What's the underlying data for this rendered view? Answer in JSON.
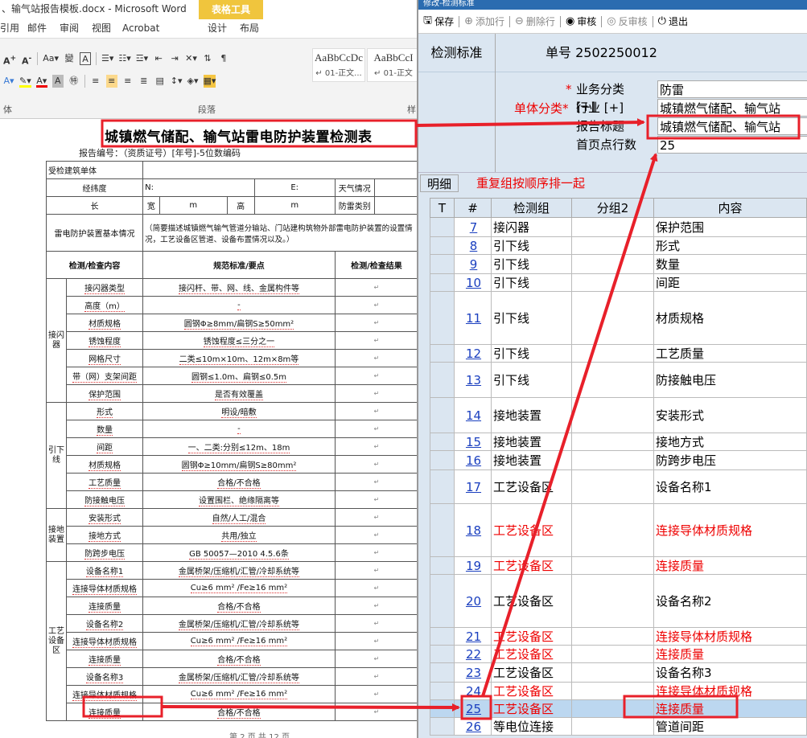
{
  "word": {
    "title": "、输气站报告模板.docx - Microsoft Word",
    "context_tab": "表格工具",
    "tabs": [
      "引用",
      "邮件",
      "审阅",
      "视图",
      "Acrobat",
      "设计",
      "布局"
    ],
    "ribbon": {
      "font_row": [
        "A",
        "A",
        "Aa",
        "变",
        "A"
      ],
      "para_label": "段落",
      "font_label": "体",
      "style1_sample": "AaBbCcDc",
      "style1_name": "↵ 01-正文...",
      "style2_sample": "AaBbCcI",
      "style2_name": "↵ 01-正文",
      "styles_label": "样"
    },
    "doc": {
      "title": "城镇燃气储配、输气站雷电防护装置检测表",
      "subtitle": "报告编号：（资质证号）[年号]-5位数编码",
      "footer": "第 2 页 共 12 页",
      "rows": {
        "r0": "受检建筑单体",
        "r1a": "经纬度",
        "r1b": "N:",
        "r1c": "E:",
        "r1d": "天气情况",
        "r2a": "长",
        "r2b": "m",
        "r2c": "宽",
        "r2d": "m",
        "r2e": "高",
        "r2f": "m",
        "r2g": "防雷类别",
        "r3a": "雷电防护装置基本情况",
        "r3b": "（简要描述城镇燃气输气管道分输站、门站建构筑物外部雷电防护装置的设置情况，工艺设备区管道、设备布置情况以及。）",
        "hdr1": "检测/检查内容",
        "hdr2": "规范标准/要点",
        "hdr3": "检测/检查结果"
      },
      "groups": [
        {
          "name": "接闪器",
          "items": [
            [
              "接闪器类型",
              "接闪杆、带、网、线、金属构件等"
            ],
            [
              "高度（m）",
              "-"
            ],
            [
              "材质规格",
              "圆钢Φ≥8mm/扁钢S≥50mm²"
            ],
            [
              "锈蚀程度",
              "锈蚀程度≤三分之一"
            ],
            [
              "网格尺寸",
              "二类≤10m×10m、12m×8m等"
            ],
            [
              "带（网）支架间距",
              "圆钢≤1.0m、扁钢≤0.5m"
            ],
            [
              "保护范围",
              "是否有效覆盖"
            ]
          ]
        },
        {
          "name": "引下线",
          "items": [
            [
              "形式",
              "明设/暗敷"
            ],
            [
              "数量",
              "-"
            ],
            [
              "间距",
              "一、二类:分别≤12m、18m"
            ],
            [
              "材质规格",
              "圆钢Φ≥10mm/扁钢S≥80mm²"
            ],
            [
              "工艺质量",
              "合格/不合格"
            ],
            [
              "防接触电压",
              "设置围栏、绝缘隔离等"
            ]
          ]
        },
        {
          "name": "接地装置",
          "items": [
            [
              "安装形式",
              "自然/人工/混合"
            ],
            [
              "接地方式",
              "共用/独立"
            ],
            [
              "防跨步电压",
              "GB 50057—2010 4.5.6条"
            ]
          ]
        },
        {
          "name": "工艺设备区",
          "items": [
            [
              "设备名称1",
              "金属桥架/压缩机/汇管/冷却系统等"
            ],
            [
              "连接导体材质规格",
              "Cu≥6 mm² /Fe≥16 mm²"
            ],
            [
              "连接质量",
              "合格/不合格"
            ],
            [
              "设备名称2",
              "金属桥架/压缩机/汇管/冷却系统等"
            ],
            [
              "连接导体材质规格",
              "Cu≥6 mm² /Fe≥16 mm²"
            ],
            [
              "连接质量",
              "合格/不合格"
            ],
            [
              "设备名称3",
              "金属桥架/压缩机/汇管/冷却系统等"
            ],
            [
              "连接导体材质规格",
              "Cu≥6 mm² /Fe≥16 mm²"
            ],
            [
              "连接质量",
              "合格/不合格"
            ]
          ]
        }
      ]
    }
  },
  "app": {
    "title": "修改-检测标准",
    "toolbar": [
      {
        "label": "保存",
        "icon": "save-icon",
        "glyph": "🖫",
        "enabled": true
      },
      {
        "label": "添加行",
        "icon": "plus-circle-icon",
        "glyph": "⊕",
        "enabled": false
      },
      {
        "label": "删除行",
        "icon": "minus-circle-icon",
        "glyph": "⊖",
        "enabled": false
      },
      {
        "label": "审核",
        "icon": "user-check-icon",
        "glyph": "◉",
        "enabled": true
      },
      {
        "label": "反审核",
        "icon": "user-uncheck-icon",
        "glyph": "◎",
        "enabled": false
      },
      {
        "label": "退出",
        "icon": "power-icon",
        "glyph": "⏻",
        "enabled": true
      }
    ],
    "header_label": "检测标准",
    "doc_number": "单号 2502250012",
    "form": {
      "category_label": "业务分类 [+]",
      "category_value": "防雷",
      "danti_label": "单体分类",
      "industry_label": "行业 [+]",
      "industry_value": "城镇燃气储配、输气站",
      "report_title_label": "报告标题",
      "report_title_value": "城镇燃气储配、输气站",
      "home_rows_label": "首页点行数",
      "home_rows_value": "25"
    },
    "detail_tab": "明细",
    "detail_note": "重复组按顺序排一起",
    "grid_headers": [
      "T",
      "#",
      "检测组",
      "分组2",
      "内容"
    ],
    "grid_rows": [
      {
        "n": "7",
        "g": "接闪器",
        "c": "保护范围",
        "h": 24,
        "red": false
      },
      {
        "n": "8",
        "g": "引下线",
        "c": "形式",
        "h": 22,
        "red": false
      },
      {
        "n": "9",
        "g": "引下线",
        "c": "数量",
        "h": 24,
        "red": false
      },
      {
        "n": "10",
        "g": "引下线",
        "c": "间距",
        "h": 22,
        "red": false
      },
      {
        "n": "11",
        "g": "引下线",
        "c": "材质规格",
        "h": 66,
        "red": false
      },
      {
        "n": "12",
        "g": "引下线",
        "c": "工艺质量",
        "h": 22,
        "red": false
      },
      {
        "n": "13",
        "g": "引下线",
        "c": "防接触电压",
        "h": 44,
        "red": false
      },
      {
        "n": "14",
        "g": "接地装置",
        "c": "安装形式",
        "h": 44,
        "red": false
      },
      {
        "n": "15",
        "g": "接地装置",
        "c": "接地方式",
        "h": 22,
        "red": false
      },
      {
        "n": "16",
        "g": "接地装置",
        "c": "防跨步电压",
        "h": 24,
        "red": false
      },
      {
        "n": "17",
        "g": "工艺设备区",
        "c": "设备名称1",
        "h": 42,
        "red": false
      },
      {
        "n": "18",
        "g": "工艺设备区",
        "c": "连接导体材质规格",
        "h": 66,
        "red": true
      },
      {
        "n": "19",
        "g": "工艺设备区",
        "c": "连接质量",
        "h": 22,
        "red": true
      },
      {
        "n": "20",
        "g": "工艺设备区",
        "c": "设备名称2",
        "h": 66,
        "red": false
      },
      {
        "n": "21",
        "g": "工艺设备区",
        "c": "连接导体材质规格",
        "h": 22,
        "red": true
      },
      {
        "n": "22",
        "g": "工艺设备区",
        "c": "连接质量",
        "h": 22,
        "red": true
      },
      {
        "n": "23",
        "g": "工艺设备区",
        "c": "设备名称3",
        "h": 24,
        "red": false
      },
      {
        "n": "24",
        "g": "工艺设备区",
        "c": "连接导体材质规格",
        "h": 22,
        "red": true
      },
      {
        "n": "25",
        "g": "工艺设备区",
        "c": "连接质量",
        "h": 22,
        "red": true,
        "selected": true
      },
      {
        "n": "26",
        "g": "等电位连接",
        "c": "管道间距",
        "h": 22,
        "red": false
      }
    ]
  },
  "annotations": {
    "color": "#e8202a"
  }
}
